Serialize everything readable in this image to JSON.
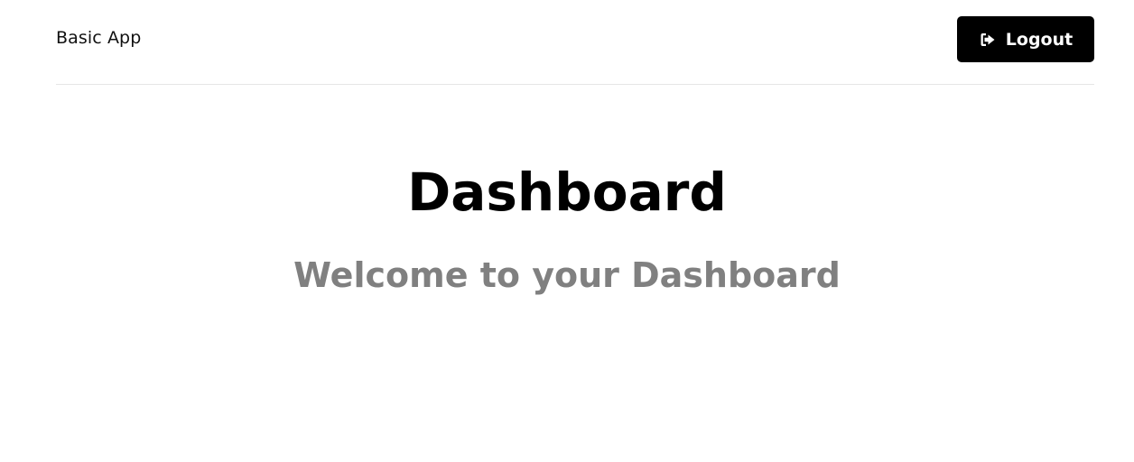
{
  "header": {
    "brand": "Basic App",
    "logout_label": "Logout",
    "logout_icon": "sign-out-icon"
  },
  "main": {
    "title": "Dashboard",
    "subtitle": "Welcome to your Dashboard"
  },
  "colors": {
    "button_bg": "#000000",
    "title": "#000000",
    "subtitle": "#808080",
    "divider": "#e6e6e6"
  }
}
